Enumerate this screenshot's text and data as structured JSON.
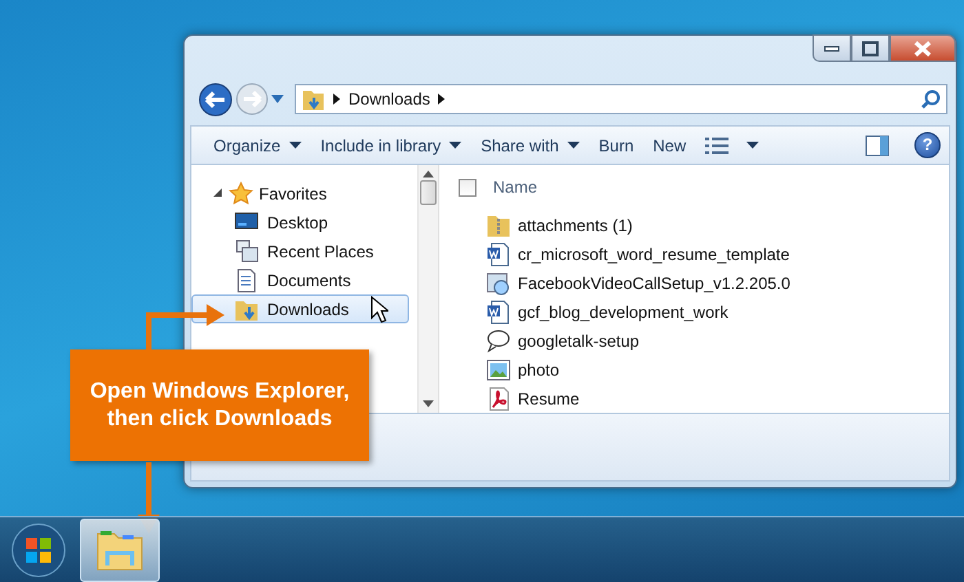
{
  "window": {
    "address": {
      "path": [
        "Downloads"
      ]
    },
    "toolbar": [
      {
        "label": "Organize",
        "dropdown": true
      },
      {
        "label": "Include in library",
        "dropdown": true
      },
      {
        "label": "Share with",
        "dropdown": true
      },
      {
        "label": "Burn",
        "dropdown": false
      },
      {
        "label": "New",
        "dropdown": false
      }
    ],
    "help_button": "?",
    "nav_pane": {
      "label": "Favorites",
      "expanded": true,
      "items": [
        {
          "label": "Desktop",
          "kind": "desktop",
          "selected": false
        },
        {
          "label": "Recent Places",
          "kind": "recent",
          "selected": false
        },
        {
          "label": "Documents",
          "kind": "documents",
          "selected": false
        },
        {
          "label": "Downloads",
          "kind": "downloads",
          "selected": true
        }
      ]
    },
    "file_list": {
      "column": "Name",
      "checked": false,
      "files": [
        {
          "name": "attachments (1)",
          "kind": "zip"
        },
        {
          "name": "cr_microsoft_word_resume_template",
          "kind": "word"
        },
        {
          "name": "FacebookVideoCallSetup_v1.2.205.0",
          "kind": "setup"
        },
        {
          "name": "gcf_blog_development_work",
          "kind": "word"
        },
        {
          "name": "googletalk-setup",
          "kind": "chat"
        },
        {
          "name": "photo",
          "kind": "image"
        },
        {
          "name": "Resume",
          "kind": "pdf"
        }
      ]
    }
  },
  "callout": {
    "text": "Open Windows Explorer,\nthen click Downloads"
  },
  "taskbar": {
    "buttons": [
      {
        "kind": "explorer",
        "active": true
      }
    ]
  }
}
